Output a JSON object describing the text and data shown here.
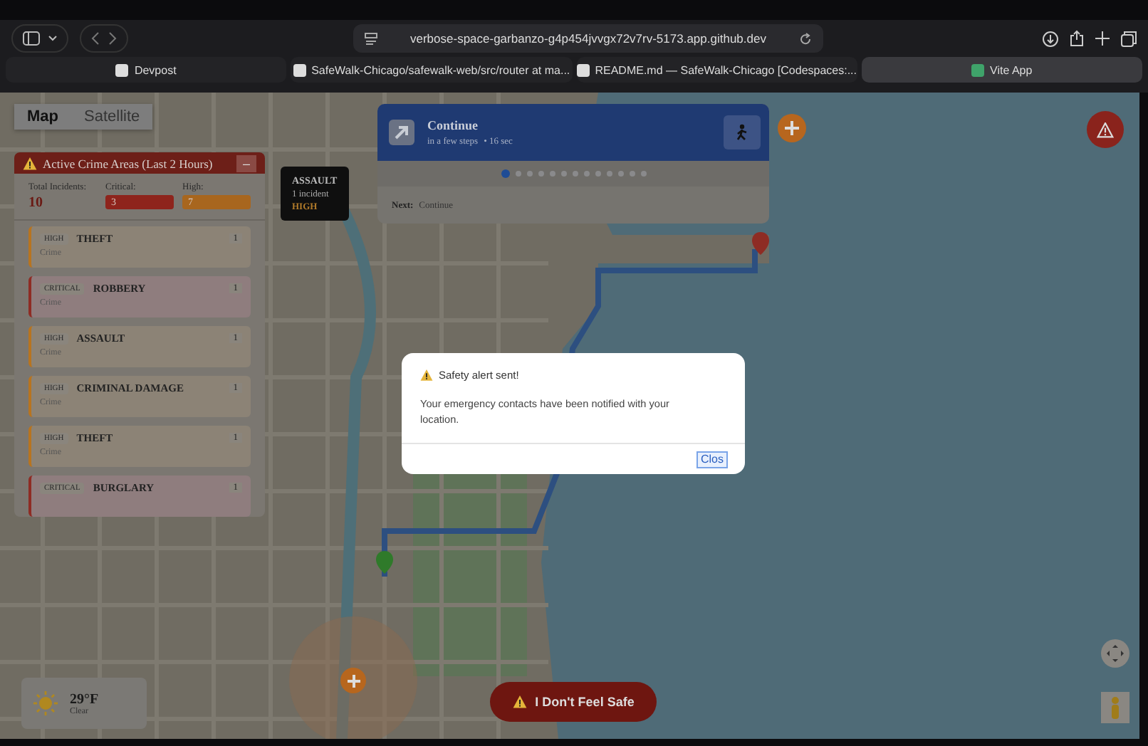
{
  "browser": {
    "url": "verbose-space-garbanzo-g4p454jvvgx72v7rv-5173.app.github.dev",
    "tabs": [
      {
        "label": "Devpost",
        "selected": false
      },
      {
        "label": "SafeWalk-Chicago/safewalk-web/src/router at ma...",
        "selected": false
      },
      {
        "label": "README.md — SafeWalk-Chicago [Codespaces:...",
        "selected": false
      },
      {
        "label": "Vite App",
        "selected": true
      }
    ]
  },
  "map_types": [
    {
      "label": "Map",
      "selected": true
    },
    {
      "label": "Satellite",
      "selected": false
    }
  ],
  "crime_panel": {
    "title": "Active Crime Areas (Last 2 Hours)",
    "collapse": "–",
    "stats": [
      {
        "label": "Total Incidents:",
        "value": "10",
        "kind": "total"
      },
      {
        "label": "Critical:",
        "value": "3",
        "kind": "critical"
      },
      {
        "label": "High:",
        "value": "7",
        "kind": "high"
      }
    ],
    "items": [
      {
        "severity": "HIGH",
        "kind": "high",
        "type": "THEFT",
        "count": "1",
        "subtitle": "Crime"
      },
      {
        "severity": "CRITICAL",
        "kind": "critical",
        "type": "ROBBERY",
        "count": "1",
        "subtitle": "Crime"
      },
      {
        "severity": "HIGH",
        "kind": "high",
        "type": "ASSAULT",
        "count": "1",
        "subtitle": "Crime"
      },
      {
        "severity": "HIGH",
        "kind": "high",
        "type": "CRIMINAL DAMAGE",
        "count": "1",
        "subtitle": "Crime"
      },
      {
        "severity": "HIGH",
        "kind": "high",
        "type": "THEFT",
        "count": "1",
        "subtitle": "Crime"
      },
      {
        "severity": "CRITICAL",
        "kind": "critical",
        "type": "BURGLARY",
        "count": "1"
      }
    ]
  },
  "crime_tooltip": {
    "type": "ASSAULT",
    "incidents": "1 incident",
    "severity": "HIGH"
  },
  "navigation": {
    "instruction": "Continue",
    "distance": "in a few steps",
    "time": "• 16 sec",
    "steps": [
      {
        "selected": true
      },
      {
        "selected": false
      },
      {
        "selected": false
      },
      {
        "selected": false
      },
      {
        "selected": false
      },
      {
        "selected": false
      },
      {
        "selected": false
      },
      {
        "selected": false
      },
      {
        "selected": false
      },
      {
        "selected": false
      },
      {
        "selected": false
      },
      {
        "selected": false
      },
      {
        "selected": false
      }
    ],
    "next_label": "Next:",
    "next": "Continue"
  },
  "dialog": {
    "title": "Safety alert sent!",
    "message": "Your emergency contacts have been notified with your location.",
    "button": "Clos"
  },
  "weather": {
    "temperature": "29°F",
    "condition": "Clear"
  },
  "sos_button": "I Don't Feel Safe"
}
